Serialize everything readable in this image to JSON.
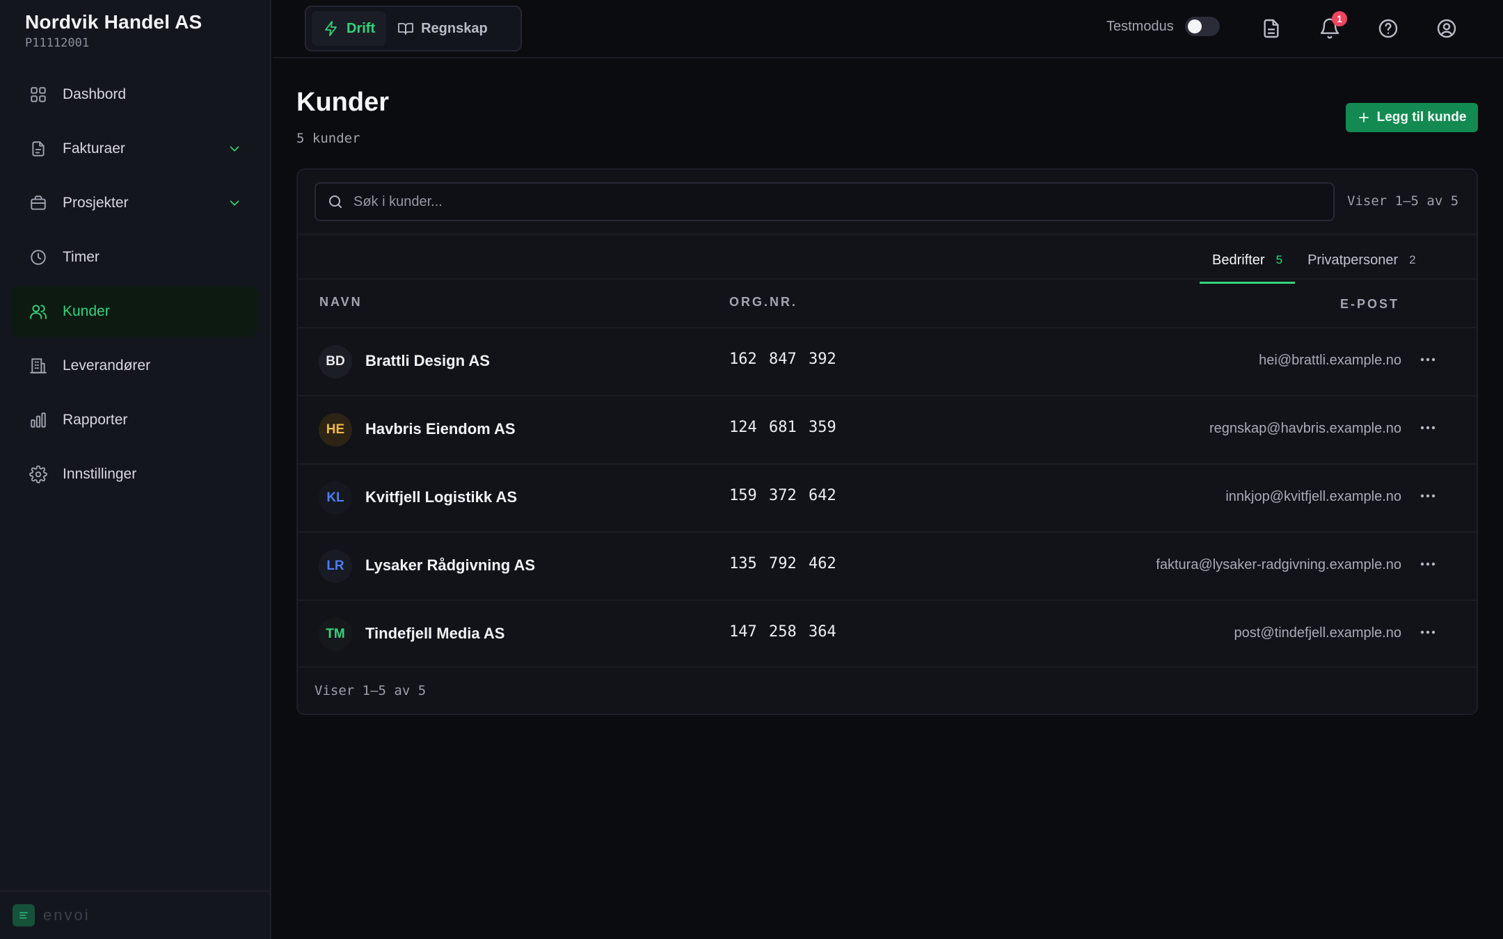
{
  "brand": {
    "name": "Nordvik Handel AS",
    "id": "P11112001"
  },
  "sidebar": {
    "items": [
      {
        "label": "Dashbord",
        "icon": "grid-icon",
        "active": false,
        "expandable": false
      },
      {
        "label": "Fakturaer",
        "icon": "document-icon",
        "active": false,
        "expandable": true
      },
      {
        "label": "Prosjekter",
        "icon": "briefcase-icon",
        "active": false,
        "expandable": true
      },
      {
        "label": "Timer",
        "icon": "clock-icon",
        "active": false,
        "expandable": false
      },
      {
        "label": "Kunder",
        "icon": "users-icon",
        "active": true,
        "expandable": false
      },
      {
        "label": "Leverandører",
        "icon": "building-icon",
        "active": false,
        "expandable": false
      },
      {
        "label": "Rapporter",
        "icon": "bar-chart-icon",
        "active": false,
        "expandable": false
      },
      {
        "label": "Innstillinger",
        "icon": "gear-icon",
        "active": false,
        "expandable": false
      }
    ],
    "footer": {
      "label": "envoi"
    }
  },
  "topbar": {
    "modes": [
      {
        "label": "Drift",
        "icon": "bolt-icon",
        "active": true
      },
      {
        "label": "Regnskap",
        "icon": "book-icon",
        "active": false
      }
    ],
    "testmode_label": "Testmodus",
    "testmode_on": false,
    "notification_count": "1"
  },
  "main": {
    "title": "Kunder",
    "subtitle": "5 kunder",
    "add_button": "Legg til kunde",
    "search_placeholder": "Søk i kunder...",
    "range_text": "Viser 1–5 av 5",
    "tabs": [
      {
        "label": "Bedrifter",
        "count": "5",
        "active": true
      },
      {
        "label": "Privatpersoner",
        "count": "2",
        "active": false
      }
    ],
    "columns": {
      "name": "NAVN",
      "orgnr": "ORG.NR.",
      "email": "E-POST"
    },
    "rows": [
      {
        "initials": "BD",
        "name": "Brattli Design AS",
        "orgnr": "162 847 392",
        "email": "hei@brattli.example.no",
        "avatar_color": "#e8e9ed",
        "avatar_bg": "#1c1e25"
      },
      {
        "initials": "HE",
        "name": "Havbris Eiendom AS",
        "orgnr": "124 681 359",
        "email": "regnskap@havbris.example.no",
        "avatar_color": "#f2b84b",
        "avatar_bg": "#2d2415"
      },
      {
        "initials": "KL",
        "name": "Kvitfjell Logistikk AS",
        "orgnr": "159 372 642",
        "email": "innkjop@kvitfjell.example.no",
        "avatar_color": "#4f7df0",
        "avatar_bg": "#15181f"
      },
      {
        "initials": "LR",
        "name": "Lysaker Rådgivning AS",
        "orgnr": "135 792 462",
        "email": "faktura@lysaker-radgivning.example.no",
        "avatar_color": "#4f7df0",
        "avatar_bg": "#181b24"
      },
      {
        "initials": "TM",
        "name": "Tindefjell Media AS",
        "orgnr": "147 258 364",
        "email": "post@tindefjell.example.no",
        "avatar_color": "#34d37b",
        "avatar_bg": "#15191b"
      }
    ]
  },
  "colors": {
    "accent": "#34d37b",
    "button": "#138a52",
    "badge": "#f0455f",
    "background": "#0b0c10",
    "sidebar": "#14161d"
  }
}
